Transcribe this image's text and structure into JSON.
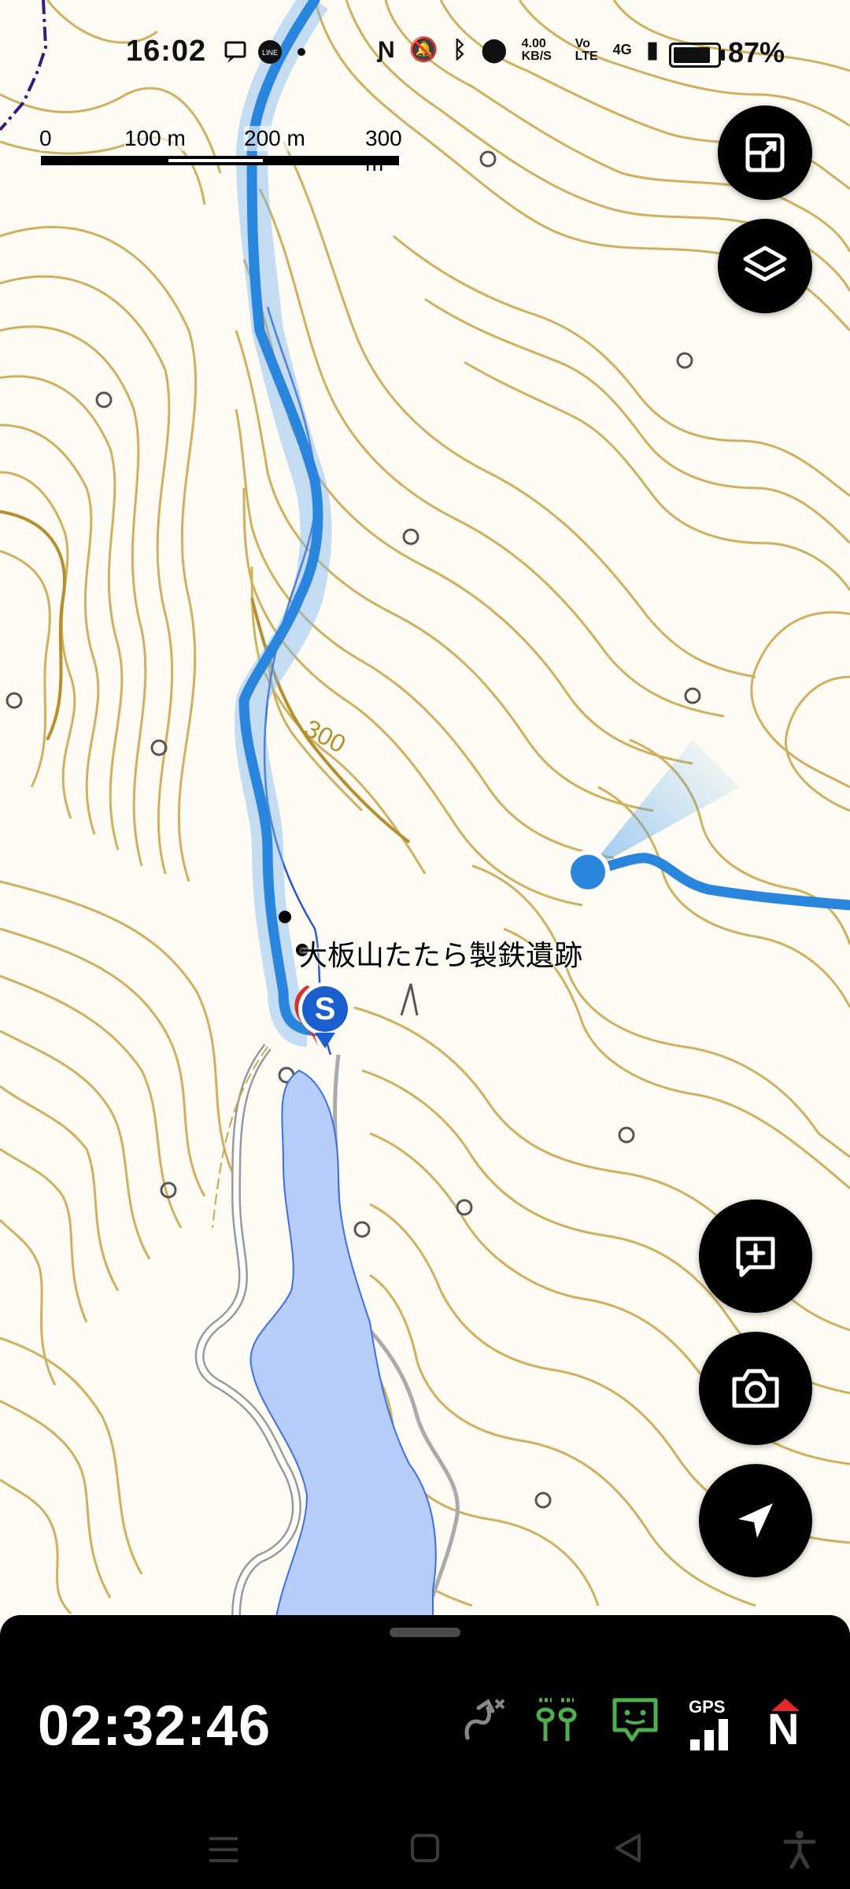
{
  "status_bar": {
    "time": "16:02",
    "network_speed": "4.00 KB/S",
    "volte": "Vo LTE",
    "network": "4G",
    "battery_percent": "87%"
  },
  "scale_bar": {
    "labels": [
      "0",
      "100 m",
      "200 m",
      "300 m"
    ]
  },
  "map": {
    "contour_label": "300",
    "poi_label": "大板山たたら製鉄遺跡",
    "start_marker_letter": "S",
    "colors": {
      "contour": "#c7a44a",
      "track": "#2a86dd",
      "water": "#b7cdfb",
      "background": "#fdfbf3"
    }
  },
  "buttons": {
    "expand": "expand-icon",
    "layers": "layers-icon",
    "add_note": "add-note-icon",
    "camera": "camera-icon",
    "locate": "navigation-arrow-icon"
  },
  "panel": {
    "elapsed_time": "02:32:46",
    "gps_label": "GPS",
    "compass_label": "N",
    "status_icon_color": "#4caf50"
  }
}
